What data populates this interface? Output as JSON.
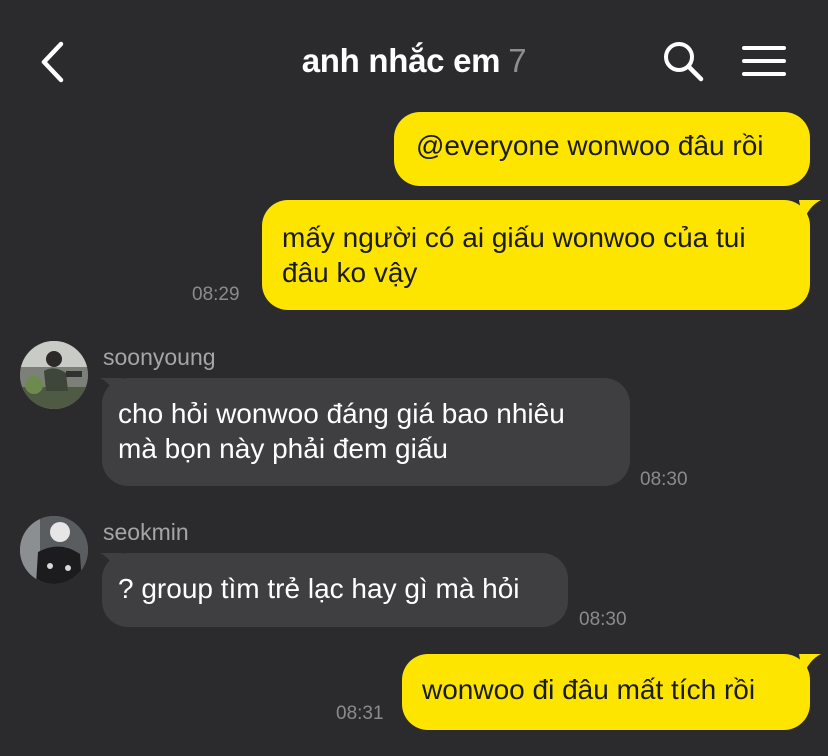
{
  "header": {
    "title": "anh nhắc em",
    "member_count": "7",
    "back_icon": "chevron-left-icon",
    "search_icon": "search-icon",
    "menu_icon": "hamburger-menu-icon"
  },
  "colors": {
    "background": "#2b2b2d",
    "my_bubble": "#fde500",
    "their_bubble": "#3f3f42",
    "timestamp": "#8b8b8e"
  },
  "messages": [
    {
      "from": "me",
      "text": "@everyone wonwoo đâu rồi"
    },
    {
      "from": "me",
      "line1": "mấy người có ai giấu wonwoo của tui",
      "line2": "đâu ko vậy",
      "time": "08:29"
    },
    {
      "from": "soonyoung",
      "sender": "soonyoung",
      "line1": "cho hỏi wonwoo đáng giá bao nhiêu",
      "line2": "mà bọn này phải đem giấu",
      "time": "08:30"
    },
    {
      "from": "seokmin",
      "sender": "seokmin",
      "text": "? group tìm trẻ lạc hay gì mà hỏi",
      "time": "08:30"
    },
    {
      "from": "me",
      "text": "wonwoo đi đâu mất tích rồi",
      "time": "08:31"
    }
  ]
}
